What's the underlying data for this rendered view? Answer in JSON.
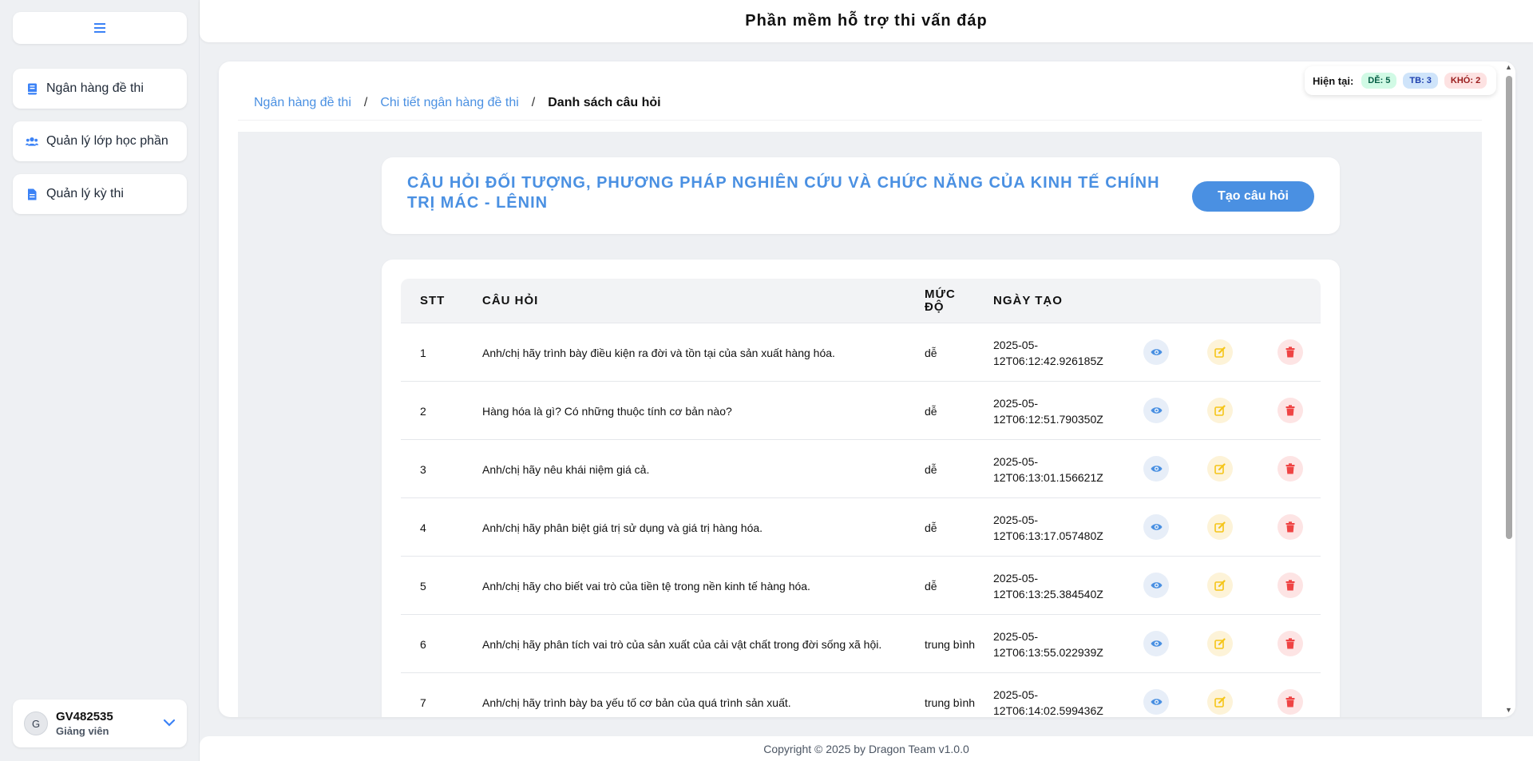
{
  "app": {
    "title": "Phần mềm hỗ trợ thi vấn đáp",
    "footer": "Copyright © 2025 by Dragon Team v1.0.0"
  },
  "sidebar": {
    "toggle_icon": "menu-icon",
    "items": [
      {
        "label": "Ngân hàng đề thi",
        "icon": "book-icon"
      },
      {
        "label": "Quản lý lớp học phần",
        "icon": "users-icon"
      },
      {
        "label": "Quản lý kỳ thi",
        "icon": "document-icon"
      }
    ],
    "user": {
      "avatar_letter": "G",
      "name": "GV482535",
      "role": "Giảng viên"
    }
  },
  "breadcrumb": {
    "items": [
      "Ngân hàng đề thi",
      "Chi tiết ngân hàng đề thi"
    ],
    "current": "Danh sách câu hỏi",
    "separator": "/"
  },
  "level_counter": {
    "label": "Hiện tại:",
    "easy": "DỄ: 5",
    "medium": "TB: 3",
    "hard": "KHÓ: 2"
  },
  "question_set": {
    "title": "CÂU HỎI ĐỐI TƯỢNG, PHƯƠNG PHÁP NGHIÊN CỨU VÀ CHỨC NĂNG CỦA KINH TẾ CHÍNH TRỊ MÁC - LÊNIN",
    "create_button": "Tạo câu hỏi"
  },
  "table": {
    "columns": [
      "STT",
      "CÂU HỎI",
      "MỨC ĐỘ",
      "NGÀY TẠO"
    ],
    "rows": [
      {
        "stt": "1",
        "question": "Anh/chị hãy trình bày điều kiện ra đời và tồn tại của sản xuất hàng hóa.",
        "level": "dễ",
        "created": "2025-05-12T06:12:42.926185Z"
      },
      {
        "stt": "2",
        "question": "Hàng hóa là gì? Có những thuộc tính cơ bản nào?",
        "level": "dễ",
        "created": "2025-05-12T06:12:51.790350Z"
      },
      {
        "stt": "3",
        "question": "Anh/chị hãy nêu khái niệm giá cả.",
        "level": "dễ",
        "created": "2025-05-12T06:13:01.156621Z"
      },
      {
        "stt": "4",
        "question": "Anh/chị hãy phân biệt giá trị sử dụng và giá trị hàng hóa.",
        "level": "dễ",
        "created": "2025-05-12T06:13:17.057480Z"
      },
      {
        "stt": "5",
        "question": "Anh/chị hãy cho biết vai trò của tiền tệ trong nền kinh tế hàng hóa.",
        "level": "dễ",
        "created": "2025-05-12T06:13:25.384540Z"
      },
      {
        "stt": "6",
        "question": "Anh/chị hãy phân tích vai trò của sản xuất của cải vật chất trong đời sống xã hội.",
        "level": "trung bình",
        "created": "2025-05-12T06:13:55.022939Z"
      },
      {
        "stt": "7",
        "question": "Anh/chị hãy trình bày ba yếu tố cơ bản của quá trình sản xuất.",
        "level": "trung bình",
        "created": "2025-05-12T06:14:02.599436Z"
      }
    ],
    "actions": {
      "view_icon": "eye-icon",
      "edit_icon": "edit-icon",
      "delete_icon": "trash-icon"
    }
  },
  "colors": {
    "accent": "#4a90e2",
    "view": "#4a90e2",
    "edit": "#f5c518",
    "delete": "#ef4444"
  }
}
